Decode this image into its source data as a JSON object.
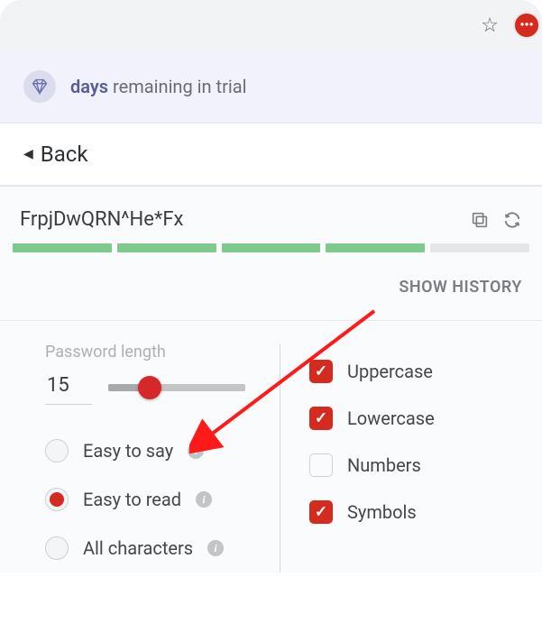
{
  "browser": {
    "ext_badge": "•••"
  },
  "banner": {
    "highlight": "days",
    "rest": "remaining in trial"
  },
  "nav": {
    "back_label": "Back"
  },
  "password": {
    "value": "FrpjDwQRN^He*Fx"
  },
  "strength": {
    "filled": 4,
    "total": 5
  },
  "history_link": "SHOW HISTORY",
  "length": {
    "label": "Password length",
    "value": "15"
  },
  "modes": {
    "easy_say": "Easy to say",
    "easy_read": "Easy to read",
    "all_chars": "All characters",
    "selected": "easy_read"
  },
  "charsets": {
    "uppercase": {
      "label": "Uppercase",
      "on": true
    },
    "lowercase": {
      "label": "Lowercase",
      "on": true
    },
    "numbers": {
      "label": "Numbers",
      "on": false
    },
    "symbols": {
      "label": "Symbols",
      "on": true
    }
  }
}
